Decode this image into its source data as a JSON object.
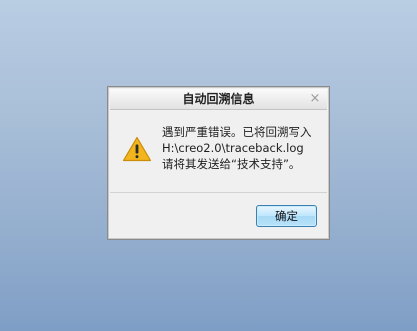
{
  "dialog": {
    "title": "自动回溯信息",
    "close_glyph": "×",
    "icon": "warning-icon",
    "message_lines": [
      "遇到严重错误。已将回溯写入",
      "H:\\creo2.0\\traceback.log",
      "请将其发送给“技术支持”。"
    ],
    "ok_label": "确定"
  },
  "colors": {
    "warning_yellow": "#f2b51d",
    "button_border": "#3c7fb1"
  }
}
